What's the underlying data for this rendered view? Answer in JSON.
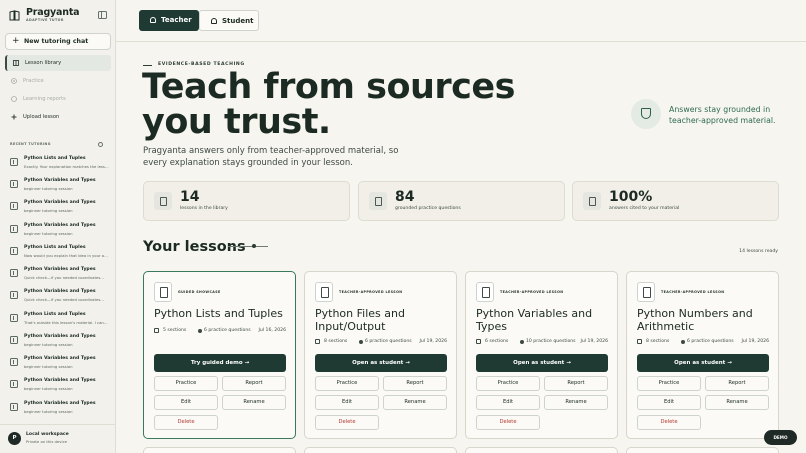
{
  "brand": {
    "name": "Pragyanta",
    "tagline": "ADAPTIVE TUTOR"
  },
  "sidebar": {
    "new_chat_label": "New tutoring chat",
    "nav": [
      {
        "label": "Lesson library",
        "state": "active"
      },
      {
        "label": "Practice",
        "state": "disabled"
      },
      {
        "label": "Learning reports",
        "state": "disabled"
      },
      {
        "label": "Upload lesson",
        "state": "normal"
      }
    ],
    "recent_label": "RECENT TUTORING",
    "recent": [
      {
        "title": "Python Lists and Tuples",
        "subtitle": "Exactly. Your explanation matches the lesson..."
      },
      {
        "title": "Python Variables and Types",
        "subtitle": "beginner tutoring session"
      },
      {
        "title": "Python Variables and Types",
        "subtitle": "beginner tutoring session"
      },
      {
        "title": "Python Variables and Types",
        "subtitle": "beginner tutoring session"
      },
      {
        "title": "Python Lists and Tuples",
        "subtitle": "Now would you explain that idea in your own words?"
      },
      {
        "title": "Python Variables and Types",
        "subtitle": "Quick check—if you needed coordinates..."
      },
      {
        "title": "Python Variables and Types",
        "subtitle": "Quick check—if you needed coordinates..."
      },
      {
        "title": "Python Lists and Tuples",
        "subtitle": "That's outside this lesson's material. I can..."
      },
      {
        "title": "Python Variables and Types",
        "subtitle": "beginner tutoring session"
      },
      {
        "title": "Python Variables and Types",
        "subtitle": "beginner tutoring session"
      },
      {
        "title": "Python Variables and Types",
        "subtitle": "beginner tutoring session"
      },
      {
        "title": "Python Variables and Types",
        "subtitle": "beginner tutoring session"
      }
    ],
    "workspace": {
      "avatar": "P",
      "title": "Local workspace",
      "subtitle": "Private on this device"
    }
  },
  "topbar": {
    "teacher_label": "Teacher",
    "student_label": "Student"
  },
  "hero": {
    "eyebrow": "EVIDENCE-BASED TEACHING",
    "title": "Teach from sources you trust.",
    "subtitle": "Pragyanta answers only from teacher-approved material, so every explanation stays grounded in your lesson.",
    "badge_text": "Answers stay grounded in teacher-approved material."
  },
  "stats": [
    {
      "value": "14",
      "label": "lessons in the library"
    },
    {
      "value": "84",
      "label": "grounded practice questions"
    },
    {
      "value": "100%",
      "label": "answers cited to your material"
    }
  ],
  "lessons": {
    "title": "Your lessons",
    "count_label": "14 lessons ready",
    "cards": [
      {
        "tag": "GUIDED SHOWCASE",
        "title": "Python Lists and Tuples",
        "sections": "5 sections",
        "questions": "6 practice questions",
        "date": "Jul 16, 2026",
        "primary": "Try guided demo →",
        "practice": "Practice",
        "report": "Report",
        "edit": "Edit",
        "rename": "Rename",
        "delete": "Delete"
      },
      {
        "tag": "TEACHER-APPROVED LESSON",
        "title": "Python Files and Input/Output",
        "sections": "8 sections",
        "questions": "6 practice questions",
        "date": "Jul 19, 2026",
        "primary": "Open as student →",
        "practice": "Practice",
        "report": "Report",
        "edit": "Edit",
        "rename": "Rename",
        "delete": "Delete"
      },
      {
        "tag": "TEACHER-APPROVED LESSON",
        "title": "Python Variables and Types",
        "sections": "6 sections",
        "questions": "10 practice questions",
        "date": "Jul 19, 2026",
        "primary": "Open as student →",
        "practice": "Practice",
        "report": "Report",
        "edit": "Edit",
        "rename": "Rename",
        "delete": "Delete"
      },
      {
        "tag": "TEACHER-APPROVED LESSON",
        "title": "Python Numbers and Arithmetic",
        "sections": "8 sections",
        "questions": "6 practice questions",
        "date": "Jul 19, 2026",
        "primary": "Open as student →",
        "practice": "Practice",
        "report": "Report",
        "edit": "Edit",
        "rename": "Rename",
        "delete": "Delete"
      }
    ]
  },
  "demo_label": "DEMO",
  "colors": {
    "primary": "#1f3a32",
    "accent": "#2f6b4f",
    "danger": "#b4372f",
    "background": "#f7f5ef"
  }
}
